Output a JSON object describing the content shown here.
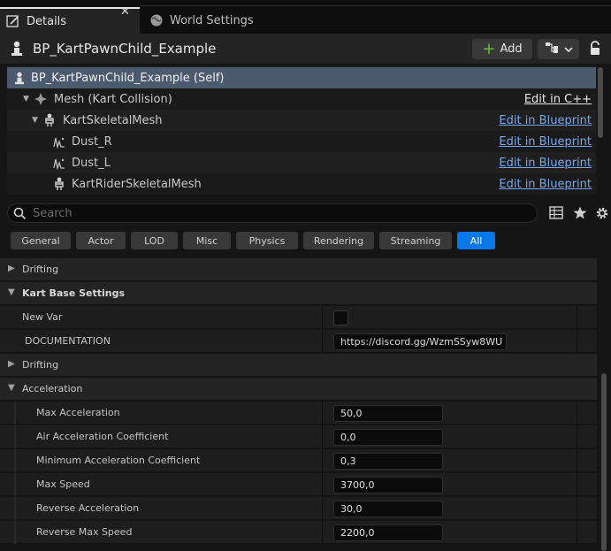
{
  "tabs": {
    "details": {
      "label": "Details",
      "close": "✕"
    },
    "world": {
      "label": "World Settings"
    }
  },
  "header": {
    "title": "BP_KartPawnChild_Example",
    "add_label": "Add"
  },
  "components": [
    {
      "label": "BP_KartPawnChild_Example (Self)",
      "link": "",
      "icon": "pawn-icon",
      "selected": true
    },
    {
      "label": "Mesh (Kart Collision)",
      "link": "Edit in C++",
      "icon": "collision-mesh-icon"
    },
    {
      "label": "KartSkeletalMesh",
      "link": "Edit in Blueprint",
      "icon": "skeletal-mesh-icon"
    },
    {
      "label": "Dust_R",
      "link": "Edit in Blueprint",
      "icon": "particle-system-icon"
    },
    {
      "label": "Dust_L",
      "link": "Edit in Blueprint",
      "icon": "particle-system-icon"
    },
    {
      "label": "KartRiderSkeletalMesh",
      "link": "Edit in Blueprint",
      "icon": "skeletal-mesh-icon"
    }
  ],
  "search": {
    "placeholder": "Search"
  },
  "filters": [
    "General",
    "Actor",
    "LOD",
    "Misc",
    "Physics",
    "Rendering",
    "Streaming",
    "All"
  ],
  "active_filter": "All",
  "sections": {
    "drifting_top": "Drifting",
    "kart_base": "Kart Base Settings",
    "new_var": {
      "label": "New Var",
      "checked": false
    },
    "documentation": {
      "label": "DOCUMENTATION",
      "value": "https://discord.gg/WzmSSyw8WU"
    },
    "drifting": "Drifting",
    "acceleration": "Acceleration"
  },
  "acceleration_props": [
    {
      "label": "Max Acceleration",
      "value": "50,0"
    },
    {
      "label": "Air Acceleration Coefficient",
      "value": "0,0"
    },
    {
      "label": "Minimum Acceleration Coefficient",
      "value": "0,3"
    },
    {
      "label": "Max Speed",
      "value": "3700,0"
    },
    {
      "label": "Reverse Acceleration",
      "value": "30,0"
    },
    {
      "label": "Reverse Max Speed",
      "value": "2200,0"
    }
  ],
  "colors": {
    "accent": "#0a78e8",
    "link": "#79a6ea",
    "selected_row": "#4b5a6e"
  }
}
